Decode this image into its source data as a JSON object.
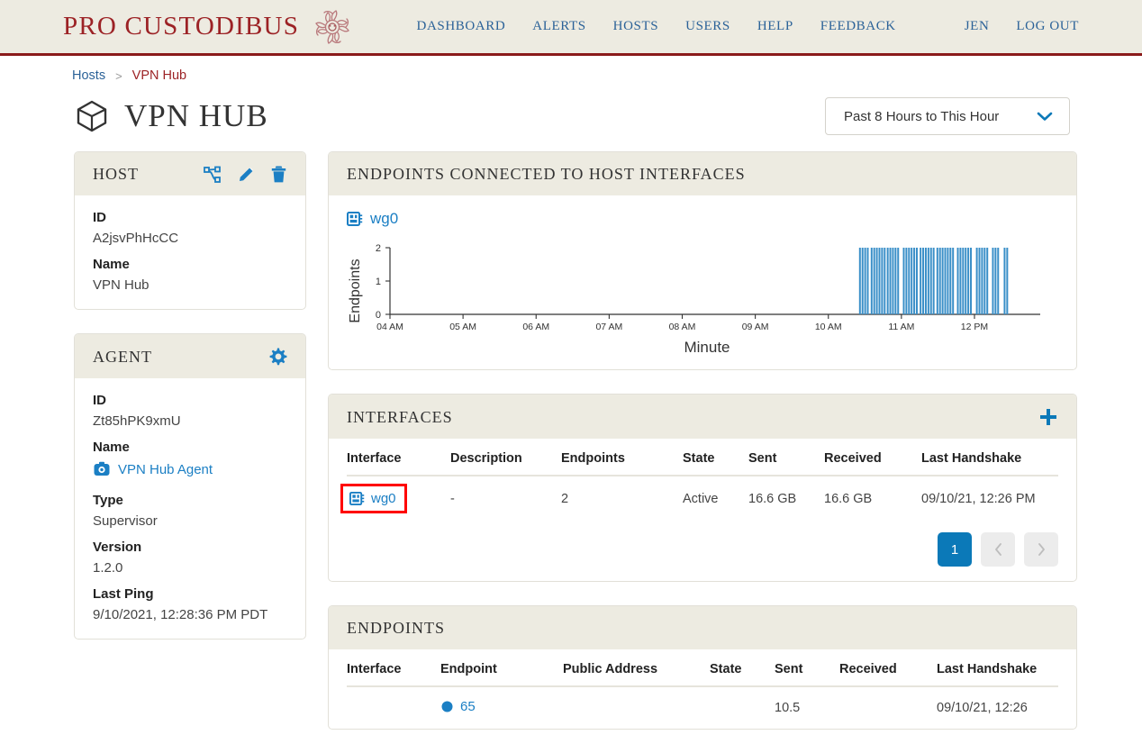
{
  "header": {
    "brand": "PRO CUSTODIBUS",
    "brand_icon": "medusa-ornament-icon",
    "brand_color": "#9c2225",
    "nav": [
      {
        "label": "DASHBOARD"
      },
      {
        "label": "ALERTS"
      },
      {
        "label": "HOSTS"
      },
      {
        "label": "USERS"
      },
      {
        "label": "HELP"
      },
      {
        "label": "FEEDBACK"
      }
    ],
    "user": "JEN",
    "logout": "LOG OUT"
  },
  "breadcrumb": {
    "parent": "Hosts",
    "separator": ">",
    "current": "VPN Hub"
  },
  "page": {
    "title": "VPN HUB",
    "title_icon": "cube-icon",
    "range_label": "Past 8 Hours to This Hour",
    "range_icon": "chevron-down-icon"
  },
  "host_card": {
    "title": "HOST",
    "actions": [
      {
        "name": "sitemap-icon"
      },
      {
        "name": "pencil-icon"
      },
      {
        "name": "trash-icon"
      }
    ],
    "fields": [
      {
        "label": "ID",
        "value": "A2jsvPhHcCC"
      },
      {
        "label": "Name",
        "value": "VPN Hub"
      }
    ]
  },
  "agent_card": {
    "title": "AGENT",
    "action": {
      "name": "gear-icon"
    },
    "id_label": "ID",
    "id_value": "Zt85hPK9xmU",
    "name_label": "Name",
    "name_value": "VPN Hub Agent",
    "name_icon": "agent-icon",
    "type_label": "Type",
    "type_value": "Supervisor",
    "version_label": "Version",
    "version_value": "1.2.0",
    "last_ping_label": "Last Ping",
    "last_ping_value": "9/10/2021, 12:28:36 PM PDT"
  },
  "chart_card": {
    "title": "ENDPOINTS CONNECTED TO HOST INTERFACES",
    "series_link": "wg0",
    "series_icon": "interface-chip-icon"
  },
  "chart_data": {
    "type": "bar",
    "title": "ENDPOINTS CONNECTED TO HOST INTERFACES",
    "series_name": "wg0",
    "xlabel": "Minute",
    "ylabel": "Endpoints",
    "ylim": [
      0,
      2
    ],
    "yticks": [
      "0",
      "1",
      "2"
    ],
    "xticks": [
      "04 AM",
      "05 AM",
      "06 AM",
      "07 AM",
      "08 AM",
      "09 AM",
      "10 AM",
      "11 AM",
      "12 PM"
    ],
    "grid": false,
    "legend": "none",
    "bar_color": "#3a8fc8",
    "x_start_hour": 4.0,
    "x_end_hour": 12.9,
    "bars": [
      {
        "start": 10.42,
        "end": 10.56,
        "value": 2
      },
      {
        "start": 10.58,
        "end": 10.78,
        "value": 2
      },
      {
        "start": 10.8,
        "end": 10.98,
        "value": 2
      },
      {
        "start": 11.02,
        "end": 11.22,
        "value": 2
      },
      {
        "start": 11.25,
        "end": 11.45,
        "value": 2
      },
      {
        "start": 11.48,
        "end": 11.72,
        "value": 2
      },
      {
        "start": 11.76,
        "end": 11.98,
        "value": 2
      },
      {
        "start": 12.02,
        "end": 12.2,
        "value": 2
      },
      {
        "start": 12.24,
        "end": 12.34,
        "value": 2
      },
      {
        "start": 12.4,
        "end": 12.47,
        "value": 2
      }
    ]
  },
  "interfaces_card": {
    "title": "INTERFACES",
    "add_icon": "plus-icon",
    "columns": [
      "Interface",
      "Description",
      "Endpoints",
      "State",
      "Sent",
      "Received",
      "Last Handshake"
    ],
    "rows": [
      {
        "interface": "wg0",
        "interface_icon": "interface-chip-icon",
        "highlighted": true,
        "description": "-",
        "endpoints": "2",
        "state": "Active",
        "sent": "16.6 GB",
        "received": "16.6 GB",
        "last_handshake": "09/10/21, 12:26 PM"
      }
    ],
    "pagination": {
      "current": "1",
      "prev_icon": "chevron-left-icon",
      "next_icon": "chevron-right-icon"
    }
  },
  "endpoints_card": {
    "title": "ENDPOINTS",
    "columns": [
      "Interface",
      "Endpoint",
      "Public Address",
      "State",
      "Sent",
      "Received",
      "Last Handshake"
    ],
    "rows": [
      {
        "interface": "",
        "endpoint": "65",
        "endpoint_icon": "endpoint-dot-icon",
        "public_address": "",
        "state": "",
        "sent": "10.5",
        "received": "",
        "last_handshake": "09/10/21, 12:26"
      }
    ]
  }
}
